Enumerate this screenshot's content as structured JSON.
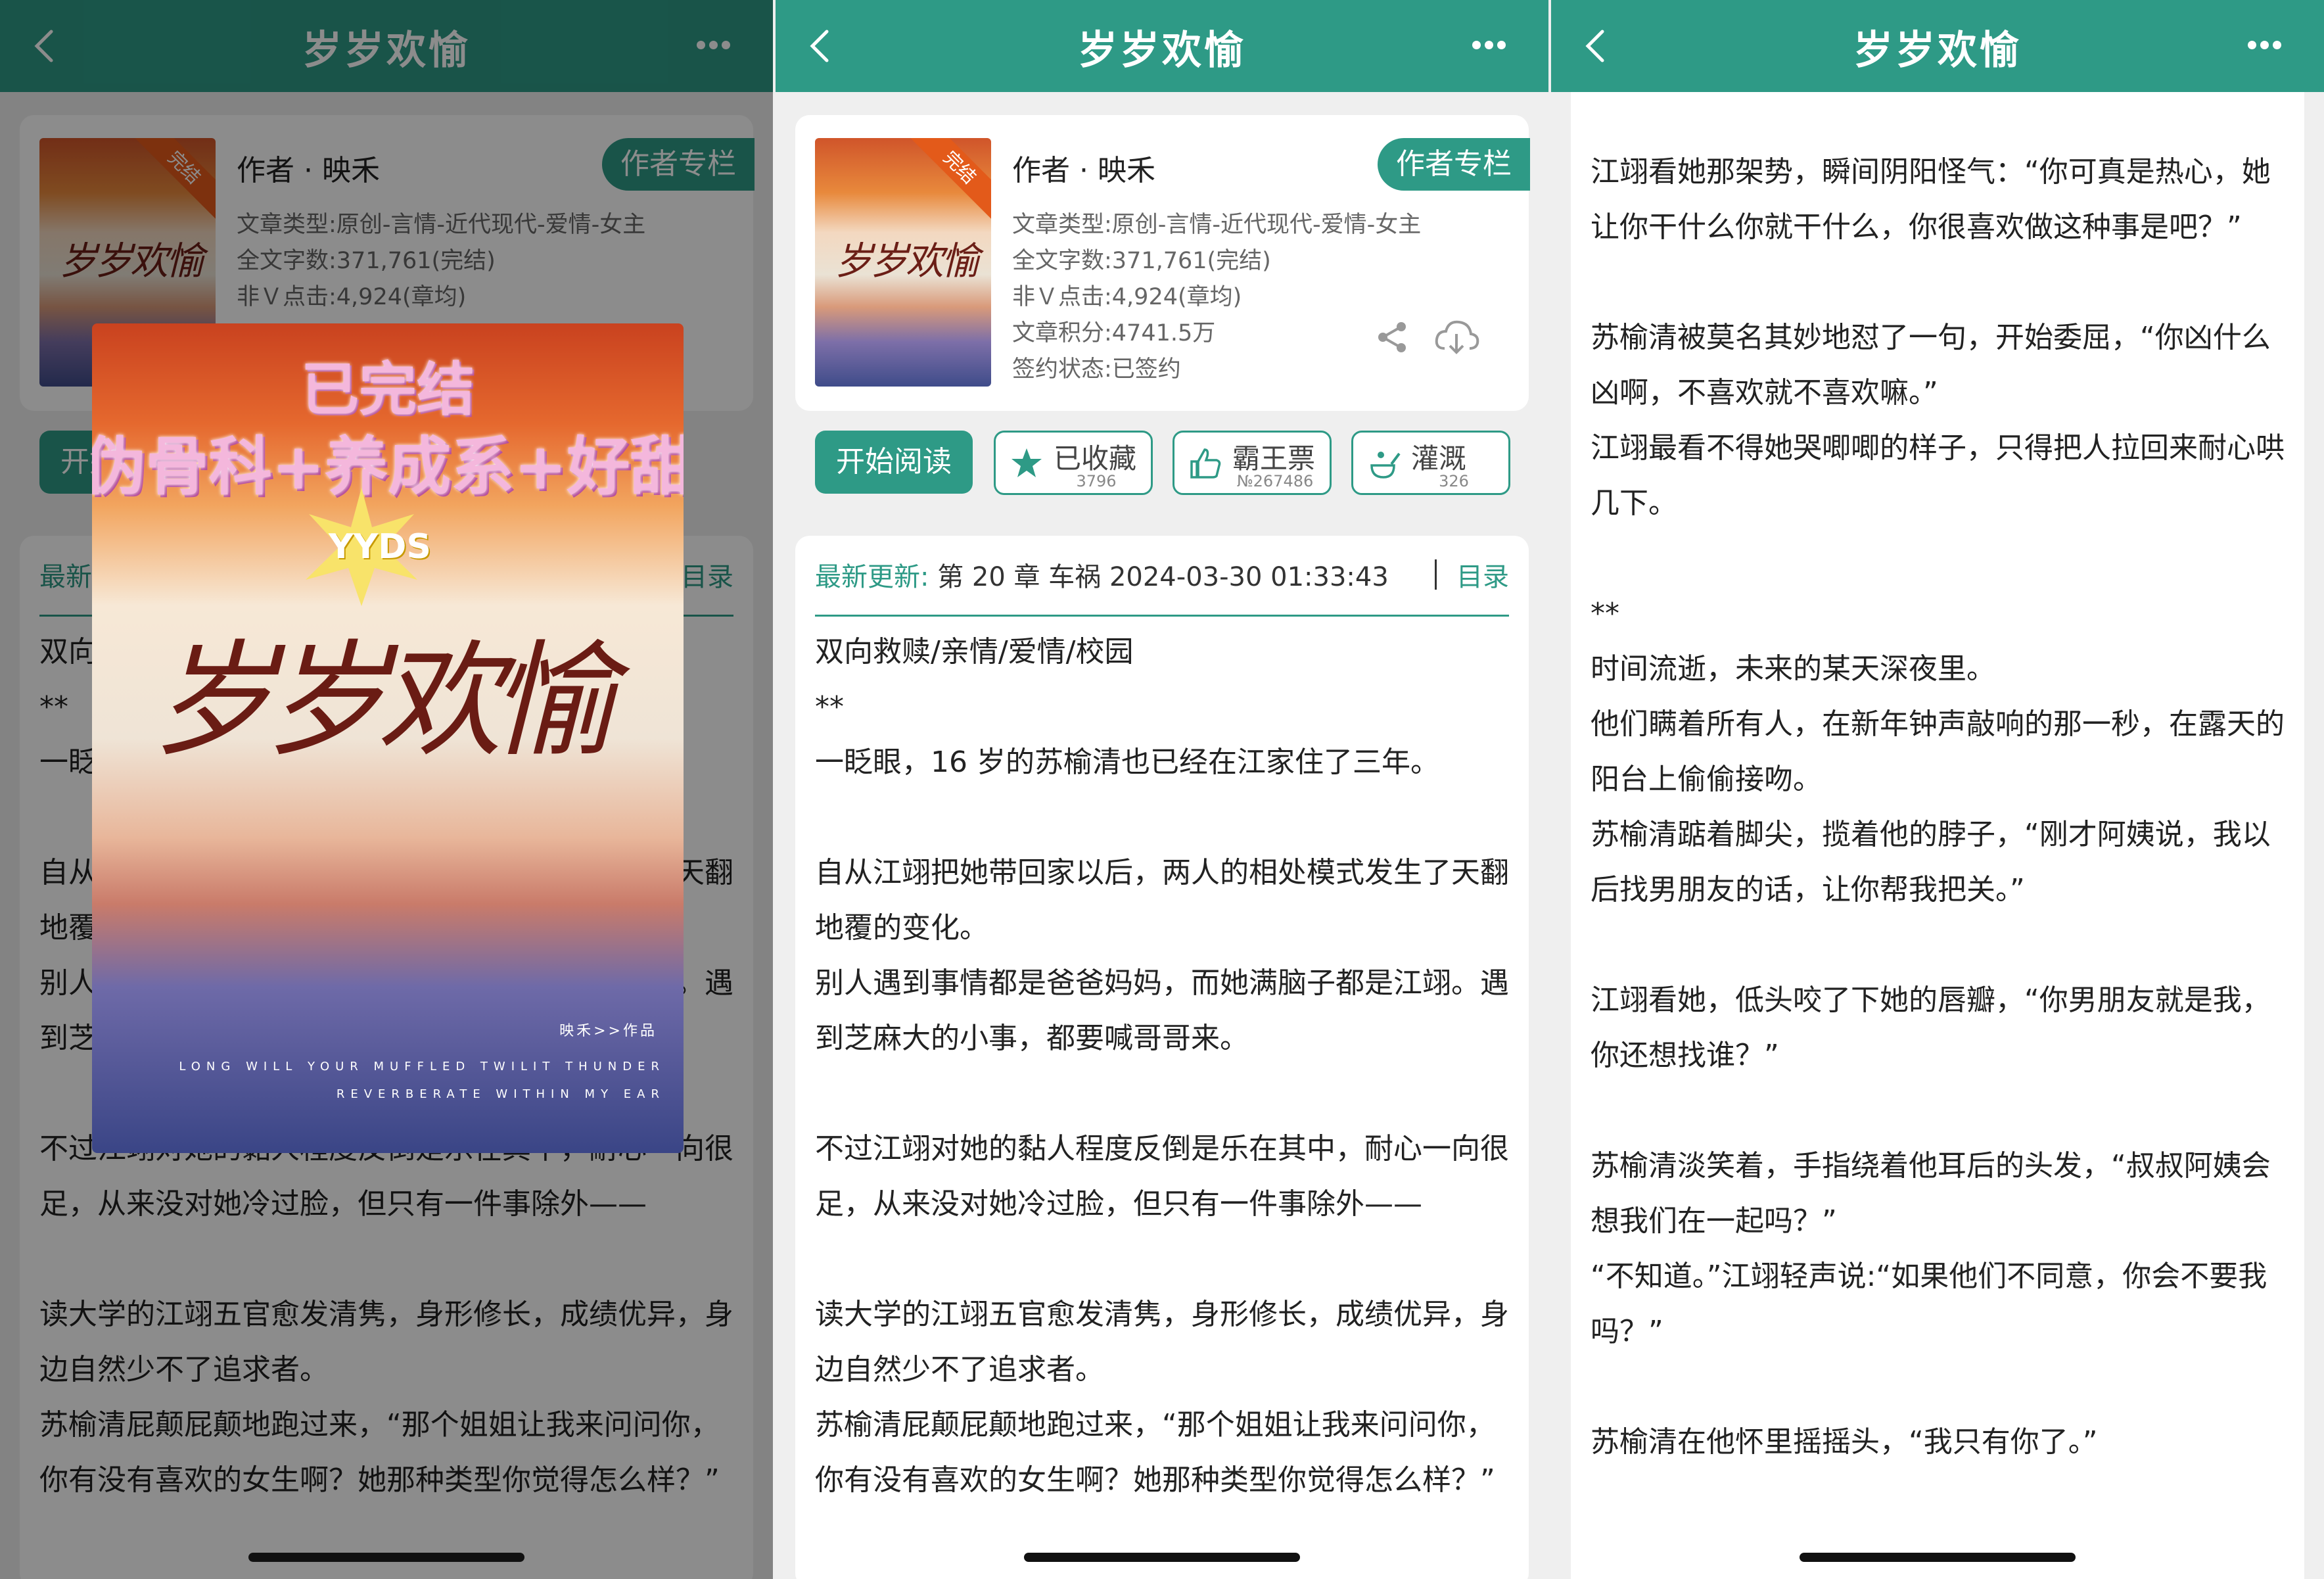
{
  "nav": {
    "title": "岁岁欢愉"
  },
  "book": {
    "cover_badge": "完结",
    "cover_title": "岁岁欢愉",
    "author": "作者 · 映禾",
    "author_column_btn": "作者专栏",
    "meta": {
      "type": "文章类型:原创-言情-近代现代-爱情-女主",
      "words": "全文字数:371,761(完结)",
      "clicks": "非Ｖ点击:4,924(章均)",
      "score": "文章积分:4741.5万",
      "status": "签约状态:已签约"
    },
    "actions": {
      "read": "开始阅读",
      "collect": {
        "label": "已收藏",
        "count": "3796"
      },
      "vote": {
        "label": "霸王票",
        "count": "№267486"
      },
      "water": {
        "label": "灌溉",
        "count": "326"
      }
    }
  },
  "latest": {
    "label": "最新更新:",
    "chapter": "第 20 章 车祸 2024-03-30 01:33:43",
    "directory": "目录"
  },
  "intro": [
    "双向救赎/亲情/爱情/校园",
    "**",
    "一眨眼，16 岁的苏榆清也已经在江家住了三年。",
    "",
    "自从江翊把她带回家以后，两人的相处模式发生了天翻地覆的变化。",
    "别人遇到事情都是爸爸妈妈，而她满脑子都是江翊。遇到芝麻大的小事，都要喊哥哥来。",
    "",
    "不过江翊对她的黏人程度反倒是乐在其中，耐心一向很足，从来没对她冷过脸，但只有一件事除外——",
    "",
    "读大学的江翊五官愈发清隽，身形修长，成绩优异，身边自然少不了追求者。",
    "苏榆清屁颠屁颠地跑过来，“那个姐姐让我来问问你，你有没有喜欢的女生啊？她那种类型你觉得怎么样？”"
  ],
  "intro_left": [
    "双向救赎/亲情/爱情/校园",
    "**",
    "一眨眼，16 岁的苏榆清也已经在江家住了三年。",
    "",
    "自从江翊把她带回家以后，两人的相处模式发生了天翻地覆的变化。",
    "别人遇到事情都是爸爸妈妈，而她满脑子都是江翊。遇到芝麻大的小事，都要喊哥哥来。",
    "",
    "不过江翊对她的黏人程度反倒是乐在其中，耐心一向很足，从来没对她冷过脸，但只有一件事除外——",
    "",
    "读大学的江翊五官愈发清隽，身形修长，成绩优异，身边自然少不了追求者。",
    "苏榆清屁颠屁颠地跑过来，“那个姐姐让我来问问你，你有没有喜欢的女生啊？她那种类型你觉得怎么样？”"
  ],
  "reader": [
    "江翊看她那架势，瞬间阴阳怪气：“你可真是热心，她让你干什么你就干什么，你很喜欢做这种事是吧？”",
    "",
    "苏榆清被莫名其妙地怼了一句，开始委屈，“你凶什么凶啊，不喜欢就不喜欢嘛。”",
    "江翊最看不得她哭唧唧的样子，只得把人拉回来耐心哄几下。",
    "",
    "**",
    "时间流逝，未来的某天深夜里。",
    "他们瞒着所有人，在新年钟声敲响的那一秒，在露天的阳台上偷偷接吻。",
    "苏榆清踮着脚尖，揽着他的脖子，“刚才阿姨说，我以后找男朋友的话，让你帮我把关。”",
    "",
    "江翊看她，低头咬了下她的唇瓣，“你男朋友就是我，你还想找谁？”",
    "",
    "苏榆清淡笑着，手指绕着他耳后的头发，“叔叔阿姨会想我们在一起吗？”",
    "“不知道。”江翊轻声说:“如果他们不同意，你会不要我吗？”",
    "",
    "苏榆清在他怀里摇摇头，“我只有你了。”"
  ],
  "big_cover": {
    "badge_line1": "已完结",
    "badge_line2": "伪骨科+养成系+好甜",
    "yyds": "YYDS",
    "title": "岁岁欢愉",
    "work": "映禾>>作品",
    "en1": "LONG WILL YOUR MUFFLED TWILIT THUNDER",
    "en2": "REVERBERATE WITHIN MY EAR"
  },
  "colors": {
    "accent": "#2e9a86",
    "overlay": "rgba(0,0,0,0.45)"
  },
  "icons": [
    "back-icon",
    "more-icon",
    "share-icon",
    "download-icon",
    "star-icon",
    "thumb-icon",
    "water-icon"
  ]
}
